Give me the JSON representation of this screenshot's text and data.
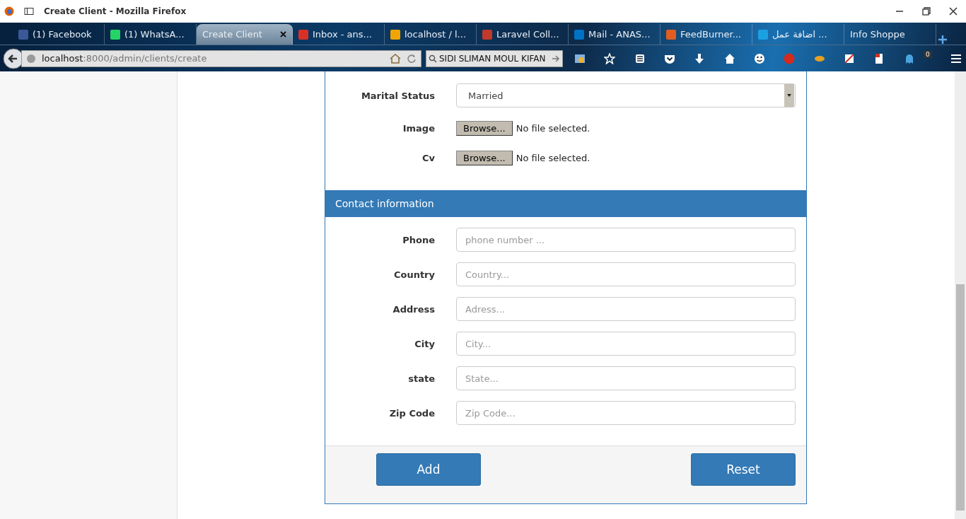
{
  "window": {
    "title": "Create Client - Mozilla Firefox"
  },
  "tabs": [
    {
      "label": "(1) Facebook",
      "selected": false
    },
    {
      "label": "(1) WhatsA...",
      "selected": false
    },
    {
      "label": "Create Client",
      "selected": true
    },
    {
      "label": "Inbox - ans...",
      "selected": false
    },
    {
      "label": "localhost / l...",
      "selected": false
    },
    {
      "label": "Laravel Coll...",
      "selected": false
    },
    {
      "label": "Mail - ANAS...",
      "selected": false
    },
    {
      "label": "FeedBurner...",
      "selected": false
    },
    {
      "label": "اضافة عمل ...",
      "selected": false
    },
    {
      "label": "Info Shoppe",
      "selected": false
    }
  ],
  "toolbar": {
    "url_host": "localhost",
    "url_path": ":8000/admin/clients/create",
    "search": "SIDI SLIMAN MOUL KIFAN",
    "notification_count": "0"
  },
  "form": {
    "rows": [
      {
        "label": "Marital Status",
        "kind": "select",
        "value": "Married"
      },
      {
        "label": "Image",
        "kind": "file",
        "button": "Browse...",
        "value": "No file selected."
      },
      {
        "label": "Cv",
        "kind": "file",
        "button": "Browse...",
        "value": "No file selected."
      }
    ],
    "section_title": "Contact information",
    "contact_rows": [
      {
        "label": "Phone",
        "kind": "text",
        "placeholder": "phone number ..."
      },
      {
        "label": "Country",
        "kind": "text",
        "placeholder": "Country..."
      },
      {
        "label": "Address",
        "kind": "text",
        "placeholder": "Adress..."
      },
      {
        "label": "City",
        "kind": "text",
        "placeholder": "City..."
      },
      {
        "label": "state",
        "kind": "text",
        "placeholder": "State..."
      },
      {
        "label": "Zip Code",
        "kind": "text",
        "placeholder": "Zip Code..."
      }
    ],
    "buttons": [
      "Add",
      "Reset"
    ]
  }
}
